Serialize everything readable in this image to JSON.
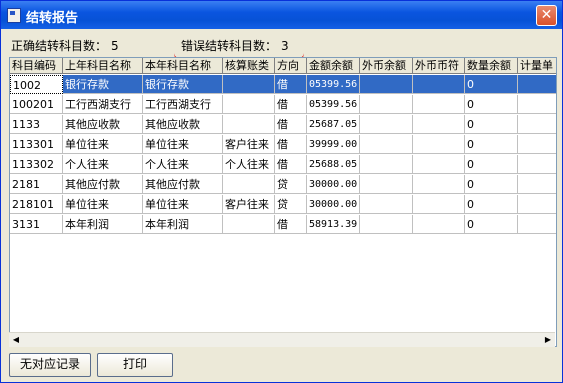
{
  "window": {
    "title": "结转报告",
    "close_glyph": "✕"
  },
  "summary": {
    "correct_label": "正确结转科目数：",
    "correct_count": "5",
    "error_label": "错误结转科目数：",
    "error_count": "3"
  },
  "columns": [
    "科目编码",
    "上年科目名称",
    "本年科目名称",
    "核算账类",
    "方向",
    "金额余额",
    "外币余额",
    "外币币符",
    "数量余额",
    "计量单"
  ],
  "rows": [
    [
      "1002",
      "银行存款",
      "银行存款",
      "",
      "借",
      "05399.56",
      "",
      "",
      "0",
      ""
    ],
    [
      "100201",
      "工行西湖支行",
      "工行西湖支行",
      "",
      "借",
      "05399.56",
      "",
      "",
      "0",
      ""
    ],
    [
      "1133",
      "其他应收款",
      "其他应收款",
      "",
      "借",
      "25687.05",
      "",
      "",
      "0",
      ""
    ],
    [
      "113301",
      "单位往来",
      "单位往来",
      "客户往来",
      "借",
      "39999.00",
      "",
      "",
      "0",
      ""
    ],
    [
      "113302",
      "个人往来",
      "个人往来",
      "个人往来",
      "借",
      "25688.05",
      "",
      "",
      "0",
      ""
    ],
    [
      "2181",
      "其他应付款",
      "其他应付款",
      "",
      "贷",
      "30000.00",
      "",
      "",
      "0",
      ""
    ],
    [
      "218101",
      "单位往来",
      "单位往来",
      "客户往来",
      "贷",
      "30000.00",
      "",
      "",
      "0",
      ""
    ],
    [
      "3131",
      "本年利润",
      "本年利润",
      "",
      "借",
      "58913.39",
      "",
      "",
      "0",
      ""
    ]
  ],
  "selected_row": 0,
  "buttons": {
    "no_match": "无对应记录",
    "print": "打印"
  },
  "colors": {
    "title_blue": "#0a55e0",
    "selection": "#316ac5",
    "annotation_red": "#e01010"
  }
}
